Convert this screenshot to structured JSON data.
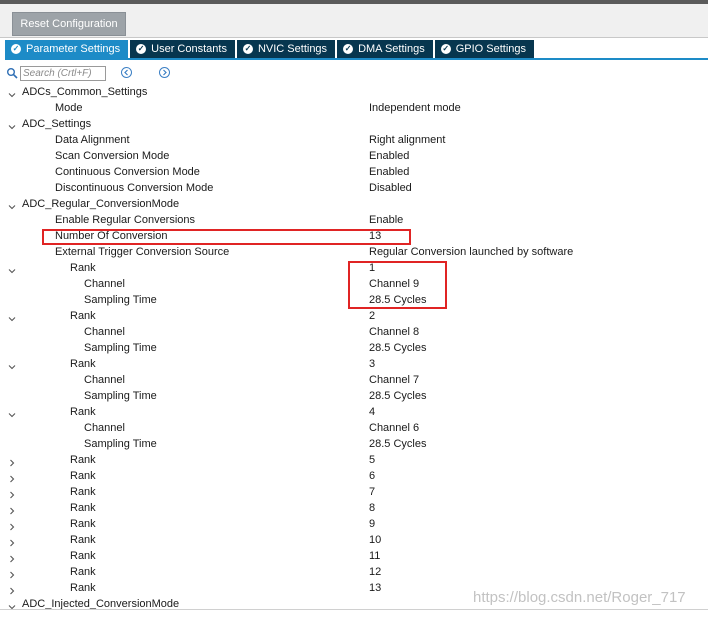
{
  "toolbar": {
    "reset_label": "Reset Configuration"
  },
  "tabs": [
    {
      "label": "Parameter Settings",
      "active": true
    },
    {
      "label": "User Constants",
      "active": false
    },
    {
      "label": "NVIC Settings",
      "active": false
    },
    {
      "label": "DMA Settings",
      "active": false
    },
    {
      "label": "GPIO Settings",
      "active": false
    }
  ],
  "search": {
    "placeholder": "Search (Crtl+F)"
  },
  "tree": [
    {
      "level": 0,
      "toggle": "expanded",
      "label": "ADCs_Common_Settings",
      "value": ""
    },
    {
      "level": 1,
      "toggle": "none",
      "label": "Mode",
      "value": "Independent mode"
    },
    {
      "level": 0,
      "toggle": "expanded",
      "label": "ADC_Settings",
      "value": ""
    },
    {
      "level": 1,
      "toggle": "none",
      "label": "Data Alignment",
      "value": "Right alignment"
    },
    {
      "level": 1,
      "toggle": "none",
      "label": "Scan Conversion Mode",
      "value": "Enabled"
    },
    {
      "level": 1,
      "toggle": "none",
      "label": "Continuous Conversion Mode",
      "value": "Enabled"
    },
    {
      "level": 1,
      "toggle": "none",
      "label": "Discontinuous Conversion Mode",
      "value": "Disabled"
    },
    {
      "level": 0,
      "toggle": "expanded",
      "label": "ADC_Regular_ConversionMode",
      "value": ""
    },
    {
      "level": 1,
      "toggle": "none",
      "label": "Enable Regular Conversions",
      "value": "Enable"
    },
    {
      "level": 1,
      "toggle": "none",
      "label": "Number Of Conversion",
      "value": "13"
    },
    {
      "level": 1,
      "toggle": "none",
      "label": "External Trigger Conversion Source",
      "value": "Regular Conversion launched by software"
    },
    {
      "level": 2,
      "toggle": "expanded",
      "label": "Rank",
      "value": "1"
    },
    {
      "level": 3,
      "toggle": "none",
      "label": "Channel",
      "value": "Channel 9"
    },
    {
      "level": 3,
      "toggle": "none",
      "label": "Sampling Time",
      "value": "28.5 Cycles"
    },
    {
      "level": 2,
      "toggle": "expanded",
      "label": "Rank",
      "value": "2"
    },
    {
      "level": 3,
      "toggle": "none",
      "label": "Channel",
      "value": "Channel 8"
    },
    {
      "level": 3,
      "toggle": "none",
      "label": "Sampling Time",
      "value": "28.5 Cycles"
    },
    {
      "level": 2,
      "toggle": "expanded",
      "label": "Rank",
      "value": "3"
    },
    {
      "level": 3,
      "toggle": "none",
      "label": "Channel",
      "value": "Channel 7"
    },
    {
      "level": 3,
      "toggle": "none",
      "label": "Sampling Time",
      "value": "28.5 Cycles"
    },
    {
      "level": 2,
      "toggle": "expanded",
      "label": "Rank",
      "value": "4"
    },
    {
      "level": 3,
      "toggle": "none",
      "label": "Channel",
      "value": "Channel 6"
    },
    {
      "level": 3,
      "toggle": "none",
      "label": "Sampling Time",
      "value": "28.5 Cycles"
    },
    {
      "level": 2,
      "toggle": "collapsed",
      "label": "Rank",
      "value": "5"
    },
    {
      "level": 2,
      "toggle": "collapsed",
      "label": "Rank",
      "value": "6"
    },
    {
      "level": 2,
      "toggle": "collapsed",
      "label": "Rank",
      "value": "7"
    },
    {
      "level": 2,
      "toggle": "collapsed",
      "label": "Rank",
      "value": "8"
    },
    {
      "level": 2,
      "toggle": "collapsed",
      "label": "Rank",
      "value": "9"
    },
    {
      "level": 2,
      "toggle": "collapsed",
      "label": "Rank",
      "value": "10"
    },
    {
      "level": 2,
      "toggle": "collapsed",
      "label": "Rank",
      "value": "11"
    },
    {
      "level": 2,
      "toggle": "collapsed",
      "label": "Rank",
      "value": "12"
    },
    {
      "level": 2,
      "toggle": "collapsed",
      "label": "Rank",
      "value": "13"
    },
    {
      "level": 0,
      "toggle": "expanded",
      "label": "ADC_Injected_ConversionMode",
      "value": ""
    }
  ],
  "watermark": "https://blog.csdn.net/Roger_717",
  "colors": {
    "tab_active": "#1d8bc7",
    "tab_inactive": "#07364f",
    "highlight": "#e02424",
    "reset_button": "#9da3a8"
  }
}
